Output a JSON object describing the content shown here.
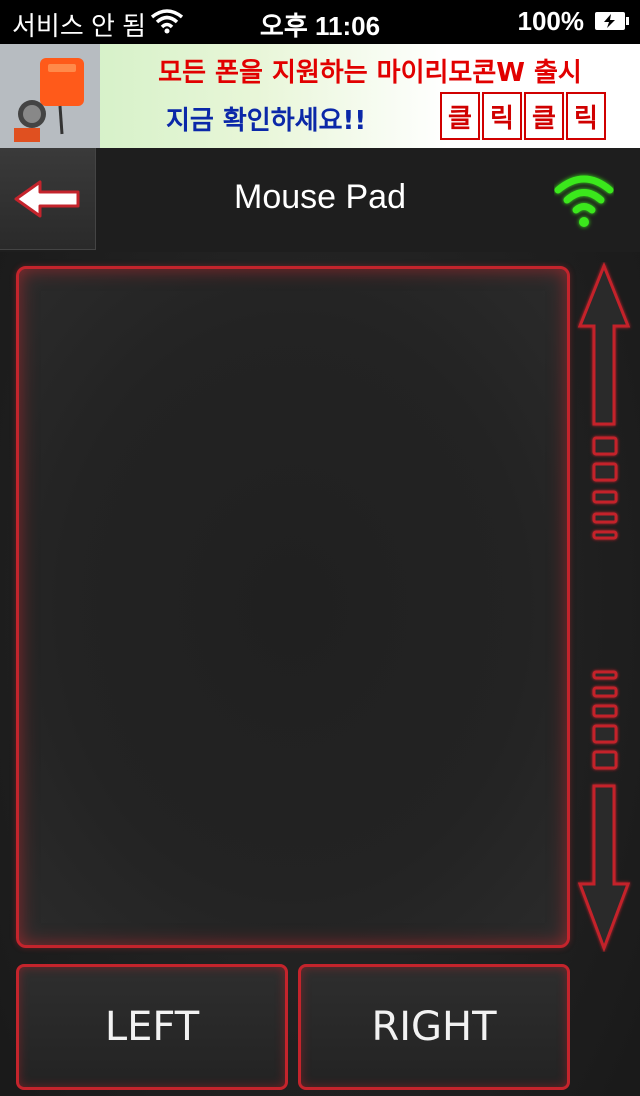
{
  "status_bar": {
    "carrier": "서비스 안 됨",
    "time": "오후 11:06",
    "battery": "100%"
  },
  "ad": {
    "line1": "모든 폰을 지원하는 마이리모콘W 출시",
    "line2": "지금 확인하세요!!",
    "click_chars": [
      "클",
      "릭",
      "클",
      "릭"
    ]
  },
  "header": {
    "title": "Mouse Pad",
    "back_icon": "back-arrow-icon",
    "connection_icon": "wifi-connected-icon"
  },
  "buttons": {
    "left": "LEFT",
    "right": "RIGHT"
  },
  "colors": {
    "accent_red": "#c4242c",
    "connected_green": "#33e81a"
  }
}
